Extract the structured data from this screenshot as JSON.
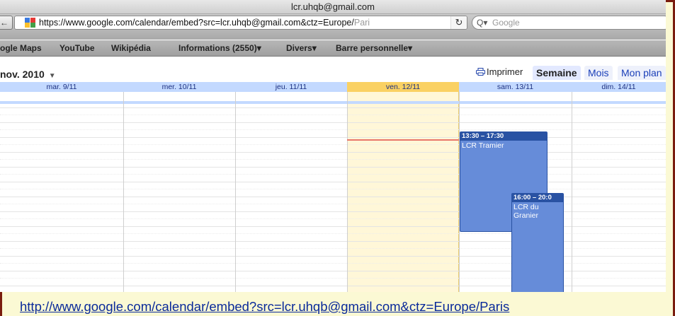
{
  "window": {
    "title": "lcr.uhqb@gmail.com"
  },
  "addressbar": {
    "url_main": "https://www.google.com/calendar/embed?src=lcr.uhqb@gmail.com&ctz=Europe/",
    "url_tail": "Pari",
    "reload_icon": "reload-icon",
    "search_placeholder": "Google"
  },
  "bookmarks": [
    {
      "label": "ogle Maps"
    },
    {
      "label": "YouTube"
    },
    {
      "label": "Wikipédia"
    },
    {
      "label": "Informations (2550)▾"
    },
    {
      "label": "Divers▾"
    },
    {
      "label": "Barre personnelle▾"
    }
  ],
  "calendar": {
    "date_range": "nov. 2010",
    "print_label": "Imprimer",
    "tabs": [
      {
        "label": "Semaine",
        "active": true
      },
      {
        "label": "Mois",
        "active": false
      },
      {
        "label": "Mon plan",
        "active": false
      }
    ],
    "days": [
      {
        "label": "mar. 9/11"
      },
      {
        "label": "mer. 10/11"
      },
      {
        "label": "jeu. 11/11"
      },
      {
        "label": "ven. 12/11",
        "today": true
      },
      {
        "label": "sam. 13/11"
      },
      {
        "label": "dim. 14/11"
      }
    ],
    "events": [
      {
        "time": "13:30 – 17:30",
        "title": "LCR Tramier"
      },
      {
        "time": "16:00 – 20:0",
        "title": "LCR du Granier"
      }
    ],
    "colors": {
      "header_bg": "#c3d9ff",
      "today_bg": "#fff7d8",
      "today_header": "#fad163",
      "event_bg": "#668cd9",
      "event_border": "#2952a3",
      "now_line": "#e9776a"
    }
  },
  "footer": {
    "link": "http://www.google.com/calendar/embed?src=lcr.uhqb@gmail.com&ctz=Europe/Paris"
  }
}
